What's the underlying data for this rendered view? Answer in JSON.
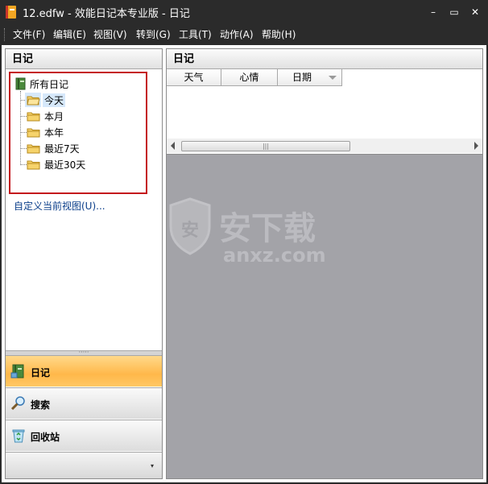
{
  "window": {
    "title": "12.edfw - 效能日记本专业版 - 日记",
    "controls": {
      "minimize": "–",
      "maximize": "▭",
      "close": "✕"
    }
  },
  "menu": [
    {
      "label": "文件(F)"
    },
    {
      "label": "编辑(E)"
    },
    {
      "label": "视图(V)"
    },
    {
      "label": "转到(G)"
    },
    {
      "label": "工具(T)"
    },
    {
      "label": "动作(A)"
    },
    {
      "label": "帮助(H)"
    }
  ],
  "left_pane": {
    "header": "日记",
    "tree": {
      "root": "所有日记",
      "children": [
        {
          "label": "今天",
          "selected": true
        },
        {
          "label": "本月"
        },
        {
          "label": "本年"
        },
        {
          "label": "最近7天"
        },
        {
          "label": "最近30天"
        }
      ]
    },
    "custom_view_link": "自定义当前视图(U)...",
    "splitter_grip": "·····",
    "nav_buttons": [
      {
        "label": "日记",
        "icon": "diary-book-icon",
        "active": true
      },
      {
        "label": "搜索",
        "icon": "magnifier-icon"
      },
      {
        "label": "回收站",
        "icon": "recycle-bin-icon"
      }
    ],
    "nav_footer_chevron": "▾"
  },
  "right_pane": {
    "header": "日记",
    "columns": [
      "天气",
      "心情",
      "日期"
    ],
    "scroll_thumb_grip": "|||"
  },
  "watermark": {
    "brand": "安下载",
    "domain": "anxz.com"
  },
  "colors": {
    "titlebar": "#2b2b2b",
    "highlight_border": "#c4161c",
    "active_nav": "#ffb84a",
    "empty_area": "#a3a3a8",
    "selected_item": "#d6e8fa"
  }
}
